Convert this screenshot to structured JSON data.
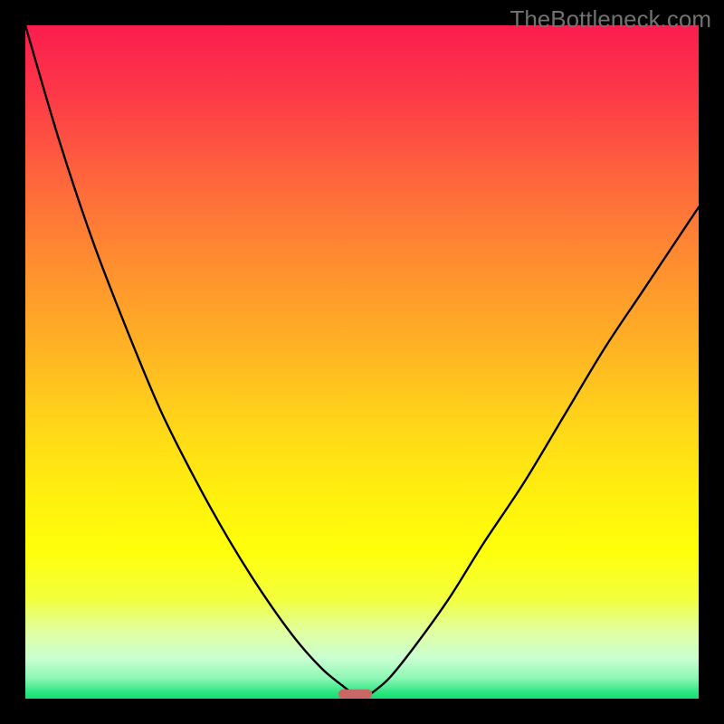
{
  "watermark": "TheBottleneck.com",
  "chart_data": {
    "type": "line",
    "title": "",
    "xlabel": "",
    "ylabel": "",
    "xlim": [
      0,
      100
    ],
    "ylim": [
      0,
      100
    ],
    "notch_x": 49,
    "notch_width": 5,
    "series": [
      {
        "name": "left-curve",
        "x": [
          0,
          5,
          10,
          15,
          20,
          25,
          30,
          35,
          40,
          44,
          47,
          49
        ],
        "y": [
          100,
          83,
          68,
          55,
          43,
          33,
          24,
          16,
          9,
          4.5,
          2,
          0.5
        ]
      },
      {
        "name": "right-curve",
        "x": [
          51,
          54,
          58,
          63,
          68,
          74,
          80,
          86,
          92,
          100
        ],
        "y": [
          0.5,
          3,
          8,
          15,
          23,
          32,
          42,
          52,
          61,
          73
        ]
      },
      {
        "name": "notch-marker",
        "x": [
          46.5,
          51.5
        ],
        "y": [
          0.7,
          0.7
        ]
      }
    ],
    "gradient_stops": [
      {
        "offset": 0,
        "color": "#fb1c4e"
      },
      {
        "offset": 10,
        "color": "#fc3848"
      },
      {
        "offset": 22,
        "color": "#fe633d"
      },
      {
        "offset": 35,
        "color": "#ff8d30"
      },
      {
        "offset": 48,
        "color": "#ffb324"
      },
      {
        "offset": 60,
        "color": "#ffd818"
      },
      {
        "offset": 70,
        "color": "#fff00e"
      },
      {
        "offset": 78,
        "color": "#ffff0a"
      },
      {
        "offset": 85,
        "color": "#f3ff3c"
      },
      {
        "offset": 90,
        "color": "#e0ffa0"
      },
      {
        "offset": 94,
        "color": "#caffd2"
      },
      {
        "offset": 97,
        "color": "#8cf7b4"
      },
      {
        "offset": 99,
        "color": "#2fe683"
      },
      {
        "offset": 100,
        "color": "#13df6f"
      }
    ],
    "curve_stroke": "#000000",
    "curve_stroke_width": 2.4,
    "notch_color": "#c96666"
  }
}
